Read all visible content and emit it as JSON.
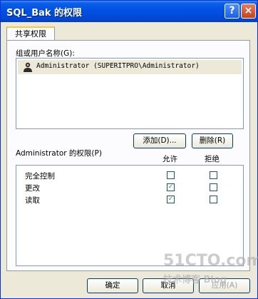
{
  "window": {
    "title": "SQL_Bak 的权限",
    "help": "?",
    "close": "×"
  },
  "tab": {
    "label": "共享权限"
  },
  "users": {
    "label": "组或用户名称(G):",
    "items": [
      {
        "name": "Administrator (SUPERITPRO\\Administrator)"
      }
    ],
    "add_button": "添加(D)...",
    "remove_button": "删除(R)"
  },
  "permissions": {
    "label": "Administrator 的权限(P)",
    "allow_header": "允许",
    "deny_header": "拒绝",
    "rows": [
      {
        "name": "完全控制",
        "allow": false,
        "deny": false
      },
      {
        "name": "更改",
        "allow": true,
        "deny": false
      },
      {
        "name": "读取",
        "allow": true,
        "deny": false
      }
    ]
  },
  "footer": {
    "ok": "确定",
    "cancel": "取消",
    "apply": "应用(A)"
  },
  "watermark": {
    "line1": "51CTO.com",
    "line2": "技术博客 Blog"
  }
}
